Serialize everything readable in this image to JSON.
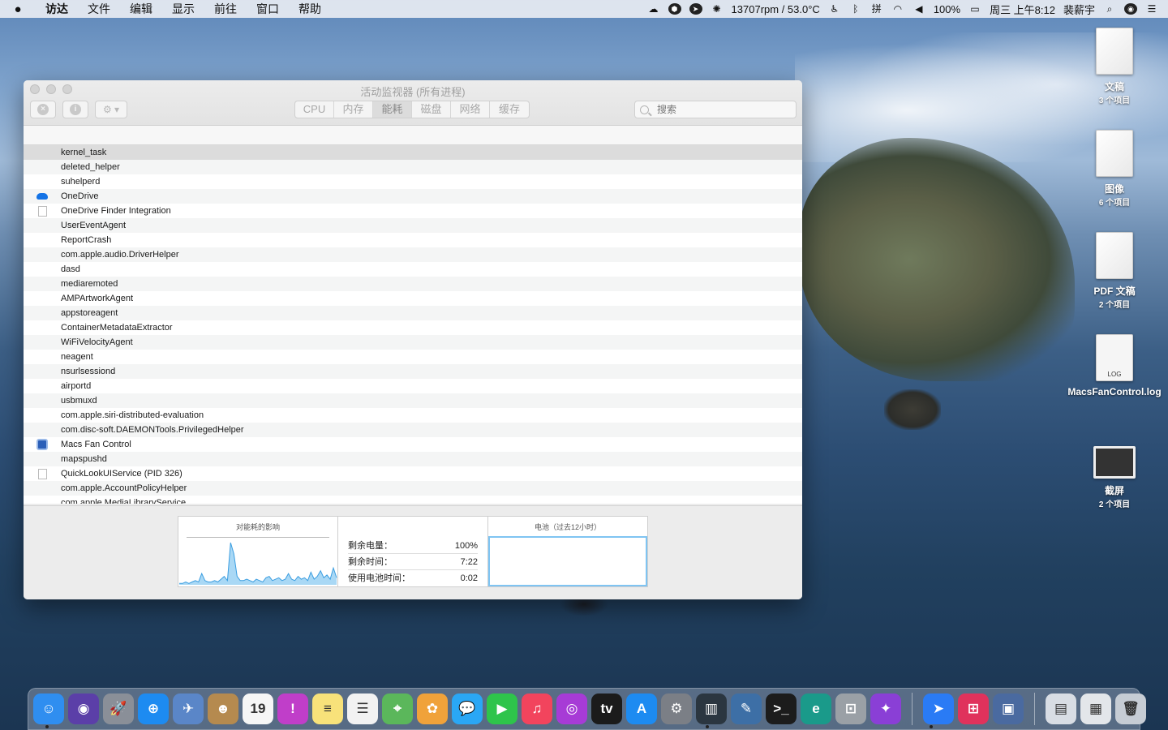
{
  "menubar": {
    "apple": "",
    "items": [
      "访达",
      "文件",
      "编辑",
      "显示",
      "前往",
      "窗口",
      "帮助"
    ],
    "fan_status": "13707rpm / 53.0°C",
    "battery": "100%",
    "clock": "周三 上午8:12",
    "user": "裴薪宇",
    "input_method": "拼"
  },
  "desktop": {
    "items": [
      {
        "name": "文稿",
        "sub": "3 个项目"
      },
      {
        "name": "图像",
        "sub": "6 个项目"
      },
      {
        "name": "PDF 文稿",
        "sub": "2 个项目"
      },
      {
        "name": "MacsFanControl.log",
        "sub": "",
        "badge": "LOG"
      },
      {
        "name": "截屏",
        "sub": "2 个项目"
      }
    ]
  },
  "window": {
    "title": "活动监视器 (所有进程)",
    "tabs": [
      "CPU",
      "内存",
      "能耗",
      "磁盘",
      "网络",
      "缓存"
    ],
    "active_tab": "能耗",
    "search_placeholder": "搜索",
    "processes": [
      {
        "name": "kernel_task",
        "icon": ""
      },
      {
        "name": "deleted_helper",
        "icon": ""
      },
      {
        "name": "suhelperd",
        "icon": ""
      },
      {
        "name": "OneDrive",
        "icon": "cloud-icon"
      },
      {
        "name": "OneDrive Finder Integration",
        "icon": "document-icon"
      },
      {
        "name": "UserEventAgent",
        "icon": ""
      },
      {
        "name": "ReportCrash",
        "icon": ""
      },
      {
        "name": "com.apple.audio.DriverHelper",
        "icon": ""
      },
      {
        "name": "dasd",
        "icon": ""
      },
      {
        "name": "mediaremoted",
        "icon": ""
      },
      {
        "name": "AMPArtworkAgent",
        "icon": ""
      },
      {
        "name": "appstoreagent",
        "icon": ""
      },
      {
        "name": "ContainerMetadataExtractor",
        "icon": ""
      },
      {
        "name": "WiFiVelocityAgent",
        "icon": ""
      },
      {
        "name": "neagent",
        "icon": ""
      },
      {
        "name": "nsurlsessiond",
        "icon": ""
      },
      {
        "name": "airportd",
        "icon": ""
      },
      {
        "name": "usbmuxd",
        "icon": ""
      },
      {
        "name": "com.apple.siri-distributed-evaluation",
        "icon": ""
      },
      {
        "name": "com.disc-soft.DAEMONTools.PrivilegedHelper",
        "icon": ""
      },
      {
        "name": "Macs Fan Control",
        "icon": "fan-icon"
      },
      {
        "name": "mapspushd",
        "icon": ""
      },
      {
        "name": "QuickLookUIService (PID 326)",
        "icon": "document-icon"
      },
      {
        "name": "com.apple.AccountPolicyHelper",
        "icon": ""
      },
      {
        "name": "com.apple.MediaLibraryService",
        "icon": ""
      }
    ],
    "bottom": {
      "energy_title": "对能耗的影响",
      "battery_title": "电池（过去12小时）",
      "stats": [
        {
          "label": "剩余电量：",
          "value": "100%"
        },
        {
          "label": "剩余时间：",
          "value": "7:22"
        },
        {
          "label": "使用电池时间：",
          "value": "0:02"
        }
      ],
      "energy_series": [
        1,
        1,
        2,
        1,
        2,
        3,
        2,
        8,
        3,
        2,
        2,
        3,
        2,
        4,
        6,
        3,
        30,
        22,
        6,
        3,
        3,
        4,
        3,
        2,
        4,
        3,
        2,
        5,
        6,
        3,
        4,
        5,
        3,
        4,
        8,
        4,
        3,
        6,
        4,
        5,
        3,
        9,
        4,
        6,
        10,
        5,
        7,
        4,
        12,
        5
      ]
    }
  },
  "dock": {
    "apps": [
      {
        "name": "finder",
        "glyph": "☺",
        "color": "#2f8ef0"
      },
      {
        "name": "siri",
        "glyph": "◉",
        "color": "#5b3fa8"
      },
      {
        "name": "launchpad",
        "glyph": "🚀",
        "color": "#8a8f98"
      },
      {
        "name": "safari",
        "glyph": "⊕",
        "color": "#1d8bf1"
      },
      {
        "name": "preview",
        "glyph": "✈",
        "color": "#5a86c8"
      },
      {
        "name": "contacts",
        "glyph": "☻",
        "color": "#b58a4f"
      },
      {
        "name": "calendar",
        "glyph": "19",
        "color": "#f6f6f6"
      },
      {
        "name": "feedback",
        "glyph": "!",
        "color": "#c03ec9"
      },
      {
        "name": "notes",
        "glyph": "≡",
        "color": "#f8e27a"
      },
      {
        "name": "reminders",
        "glyph": "☰",
        "color": "#f2f2f2"
      },
      {
        "name": "maps",
        "glyph": "⌖",
        "color": "#5bb75b"
      },
      {
        "name": "photos",
        "glyph": "✿",
        "color": "#f0a23a"
      },
      {
        "name": "messages",
        "glyph": "💬",
        "color": "#2aa7f5"
      },
      {
        "name": "facetime",
        "glyph": "▶",
        "color": "#2ec44b"
      },
      {
        "name": "music",
        "glyph": "♫",
        "color": "#f2445d"
      },
      {
        "name": "podcasts",
        "glyph": "◎",
        "color": "#a73bd6"
      },
      {
        "name": "apple-tv",
        "glyph": "tv",
        "color": "#1b1b1b"
      },
      {
        "name": "app-store",
        "glyph": "A",
        "color": "#1d8bf1"
      },
      {
        "name": "system-preferences",
        "glyph": "⚙",
        "color": "#7b7f86"
      },
      {
        "name": "activity-monitor",
        "glyph": "▥",
        "color": "#2b3640"
      },
      {
        "name": "python-launcher",
        "glyph": "✎",
        "color": "#3d6fa6"
      },
      {
        "name": "terminal",
        "glyph": ">_",
        "color": "#1c1c1c"
      },
      {
        "name": "edge-canary",
        "glyph": "e",
        "color": "#1a9a8a"
      },
      {
        "name": "screenshot",
        "glyph": "⊡",
        "color": "#9aa0a6"
      },
      {
        "name": "compass",
        "glyph": "✦",
        "color": "#8a3fd6"
      },
      {
        "name": "feishu",
        "glyph": "➤",
        "color": "#2a7bf5"
      },
      {
        "name": "scanner",
        "glyph": "⊞",
        "color": "#e0325c"
      },
      {
        "name": "image-viewer",
        "glyph": "▣",
        "color": "#4a6aa0"
      },
      {
        "name": "downloads-stack",
        "glyph": "▤",
        "color": "#d8dde4"
      },
      {
        "name": "documents-stack",
        "glyph": "▦",
        "color": "#e3e6ea"
      },
      {
        "name": "trash",
        "glyph": "🗑",
        "color": "#c6ccd4"
      }
    ]
  }
}
